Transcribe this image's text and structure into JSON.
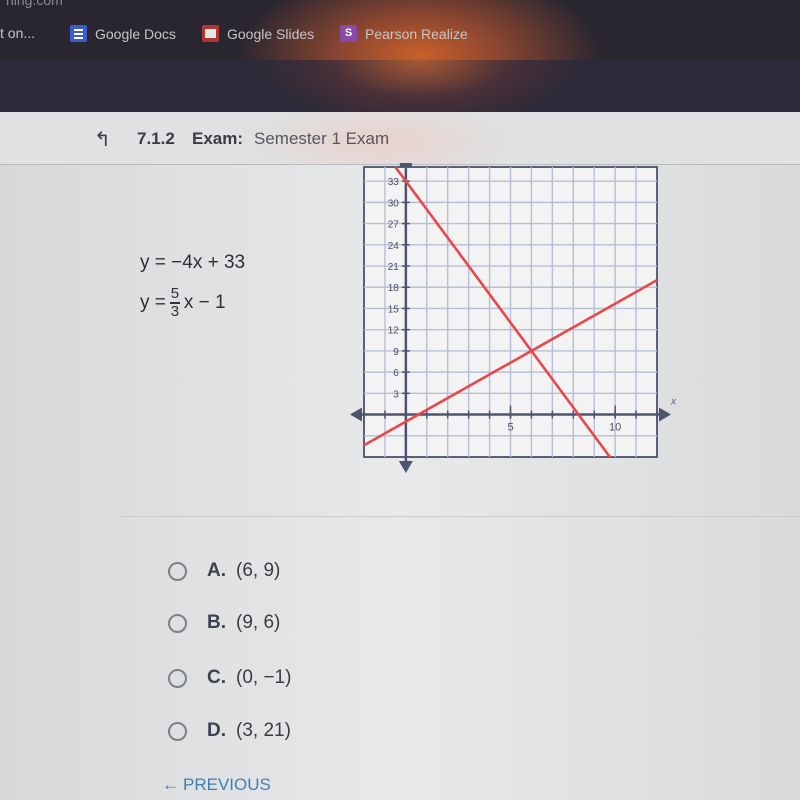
{
  "browser": {
    "partial_url": "ning.com",
    "bookmarks": [
      {
        "label": "t on...",
        "icon": "bookmark-partial"
      },
      {
        "label": "Google Docs",
        "icon": "google-docs-icon"
      },
      {
        "label": "Google Slides",
        "icon": "google-slides-icon"
      },
      {
        "label": "Pearson Realize",
        "icon": "pearson-icon",
        "icon_text": "S"
      }
    ]
  },
  "header": {
    "back_icon": "↰",
    "number": "7.1.2",
    "label": "Exam:",
    "title": "Semester 1 Exam"
  },
  "question": {
    "equation1": "y = −4x + 33",
    "equation2_prefix": "y =",
    "equation2_num": "5",
    "equation2_den": "3",
    "equation2_suffix": "x − 1"
  },
  "chart_data": {
    "type": "line",
    "title": "",
    "xlabel": "x",
    "ylabel": "",
    "xlim": [
      -2,
      12
    ],
    "ylim": [
      -6,
      35
    ],
    "x_ticks": [
      5,
      10
    ],
    "x_tick_labels": [
      "5",
      "10"
    ],
    "y_ticks": [
      3,
      6,
      9,
      12,
      15,
      18,
      21,
      24,
      27,
      30,
      33
    ],
    "y_tick_labels": [
      "3",
      "6",
      "9",
      "12",
      "15",
      "18",
      "21",
      "24",
      "27",
      "30",
      "33"
    ],
    "x_grid_step": 1,
    "y_grid_step": 3,
    "grid": true,
    "line_color": "#e8474c",
    "series": [
      {
        "name": "y = -4x + 33",
        "slope": -4,
        "intercept": 33
      },
      {
        "name": "y = 5/3 x - 1",
        "slope": 1.6667,
        "intercept": -1
      }
    ],
    "intersection": [
      6,
      9
    ]
  },
  "options": [
    {
      "letter": "A.",
      "value": "(6, 9)"
    },
    {
      "letter": "B.",
      "value": "(9, 6)"
    },
    {
      "letter": "C.",
      "value": "(0, −1)"
    },
    {
      "letter": "D.",
      "value": "(3, 21)"
    }
  ],
  "nav": {
    "previous_label": "PREVIOUS",
    "previous_icon": "←"
  }
}
